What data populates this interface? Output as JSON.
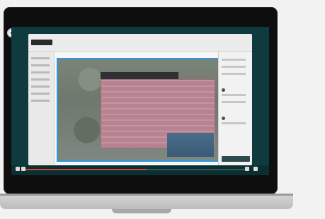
{
  "device": {
    "type": "laptop",
    "colors": {
      "bezel": "#0e0e0f",
      "screen_bg": "#0f3b3e",
      "accent_blue": "#2f97e2",
      "accent_red": "#da3b3b"
    }
  },
  "app": {
    "title": "",
    "left_panel_rows": 7,
    "right_panel_rows": 6
  },
  "player": {
    "progress_fraction": 0.55,
    "controls": [
      "play-icon",
      "volume-icon",
      "settings-icon",
      "fullscreen-icon"
    ]
  },
  "icons": {
    "logo": "logo-icon",
    "top_right_1": "window-icon",
    "top_right_2": "close-icon"
  }
}
